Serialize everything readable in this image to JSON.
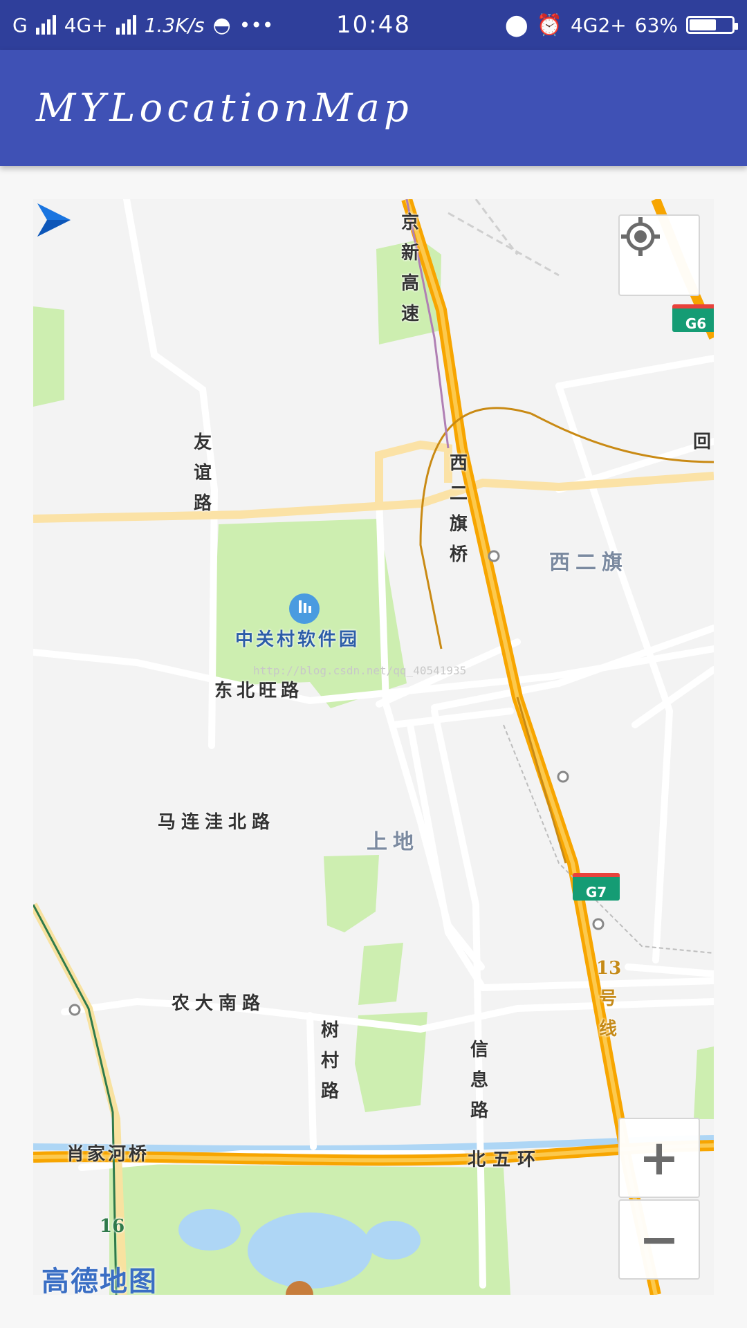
{
  "status_bar": {
    "carrier1": "G",
    "carrier2": "4G+",
    "speed": "1.3K/s",
    "more": "•••",
    "time": "10:48",
    "network2": "4G2+",
    "battery": "63%",
    "battery_level": 0.63,
    "icons": [
      "signal-icon",
      "qq-icon",
      "location-icon",
      "alarm-icon",
      "battery-icon"
    ]
  },
  "app_bar": {
    "title": "MYLocationMap"
  },
  "map": {
    "watermark": "http://blog.csdn.net/qq_40541935",
    "logo": "高德地图",
    "labels": {
      "jingxin": "京新高速",
      "youyi": "友谊路",
      "xierqiqiao": "西二旗桥",
      "xierqi": "西二旗",
      "hui": "回",
      "zhongguancun": "中关村软件园",
      "dongbeiwang": "东北旺路",
      "maliandwa": "马连洼北路",
      "shangdi": "上地",
      "nongda": "农大南路",
      "shucun": "树村路",
      "xinxi": "信息路",
      "xiaojiahe": "肖家河桥",
      "beiwuhuan": "北五环",
      "line13": "13号线",
      "line16": "16"
    },
    "shields": {
      "g6": "G6",
      "g7": "G7"
    },
    "controls": {
      "locate": "locate-icon",
      "zoom_in": "+",
      "zoom_out": "−"
    },
    "colors": {
      "expressway": "#f7a500",
      "road": "#ffffff",
      "arterial": "#fbe2a6",
      "green": "#cdeeb0",
      "water": "#aed6f5",
      "metro": "#c98a14",
      "shield": "#159c74"
    }
  }
}
